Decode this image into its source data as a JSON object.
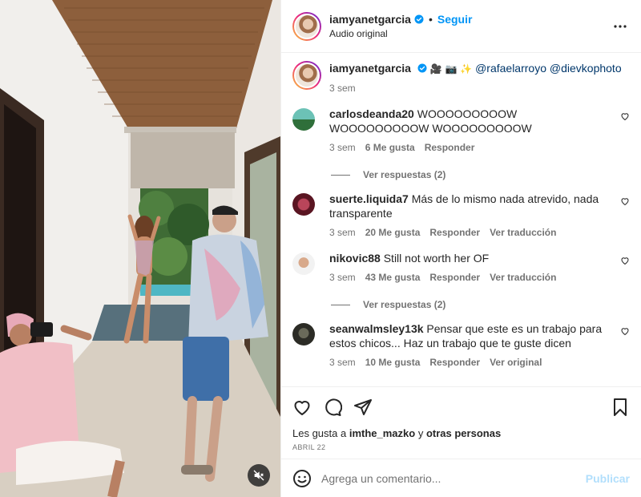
{
  "header": {
    "username": "iamyanetgarcia",
    "follow_label": "Seguir",
    "audio_label": "Audio original",
    "dot": "•"
  },
  "caption": {
    "username": "iamyanetgarcia",
    "emojis": "🎥 📷 ✨",
    "mention1": "@rafaelarroyo",
    "mention2": "@dievkophoto",
    "time": "3 sem"
  },
  "comments": [
    {
      "username": "carlosdeanda20",
      "text": "WOOOOOOOOOW WOOOOOOOOOW WOOOOOOOOOW",
      "time": "3 sem",
      "likes": "6 Me gusta",
      "reply": "Responder",
      "extra": "",
      "replies": "Ver respuestas (2)"
    },
    {
      "username": "suerte.liquida7",
      "text": "Más de lo mismo nada atrevido, nada transparente",
      "time": "3 sem",
      "likes": "20 Me gusta",
      "reply": "Responder",
      "extra": "Ver traducción"
    },
    {
      "username": "nikovic88",
      "text": "Still not worth her OF",
      "time": "3 sem",
      "likes": "43 Me gusta",
      "reply": "Responder",
      "extra": "Ver traducción",
      "replies": "Ver respuestas (2)"
    },
    {
      "username": "seanwalmsley13k",
      "text": "Pensar que este es un trabajo para estos chicos... Haz un trabajo que te guste dicen",
      "time": "3 sem",
      "likes": "10 Me gusta",
      "reply": "Responder",
      "extra": "Ver original"
    }
  ],
  "actions": {
    "likes_prefix": "Les gusta a",
    "likes_user": "imthe_mazko",
    "likes_and": "y",
    "likes_others": "otras personas",
    "date": "ABRIL 22"
  },
  "add_comment": {
    "placeholder": "Agrega un comentario...",
    "post_label": "Publicar"
  },
  "icons": [
    "verified-icon",
    "more-icon",
    "heart-icon",
    "comment-icon",
    "share-icon",
    "bookmark-icon",
    "emoji-icon",
    "mute-icon"
  ],
  "colors": {
    "accent": "#0095f6",
    "mention": "#00376b",
    "muted": "#737373",
    "post_disabled": "#b2dffc"
  }
}
